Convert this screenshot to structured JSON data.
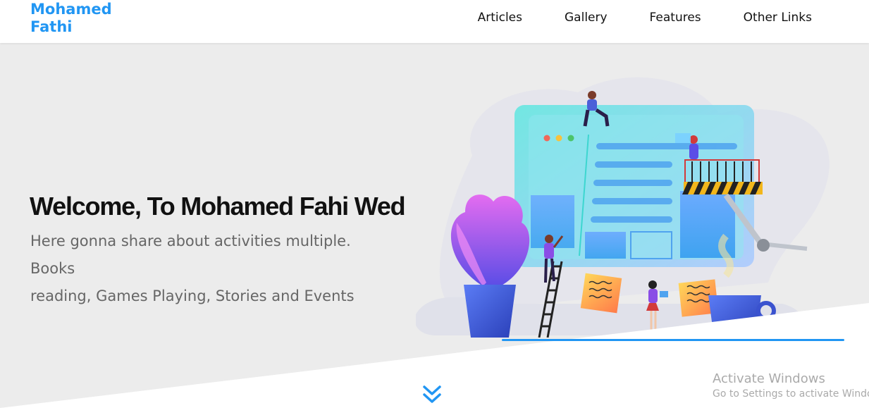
{
  "header": {
    "logo_line1": "Mohamed",
    "logo_line2": "Fathi",
    "nav": [
      "Articles",
      "Gallery",
      "Features",
      "Other Links"
    ]
  },
  "hero": {
    "title": "Welcome, To Mohamed Fahi Wed",
    "text_line1": "Here gonna share about activities multiple. Books",
    "text_line2": "reading, Games Playing, Stories and Events",
    "illustration": "web-design-illustration"
  },
  "scroll_icon": "double-chevron-down-icon",
  "watermark": {
    "title": "Activate Windows",
    "subtitle": "Go to Settings to activate Window"
  },
  "colors": {
    "accent": "#2196f3",
    "hero_bg": "#ececec",
    "title": "#111111",
    "body_text": "#666666"
  }
}
